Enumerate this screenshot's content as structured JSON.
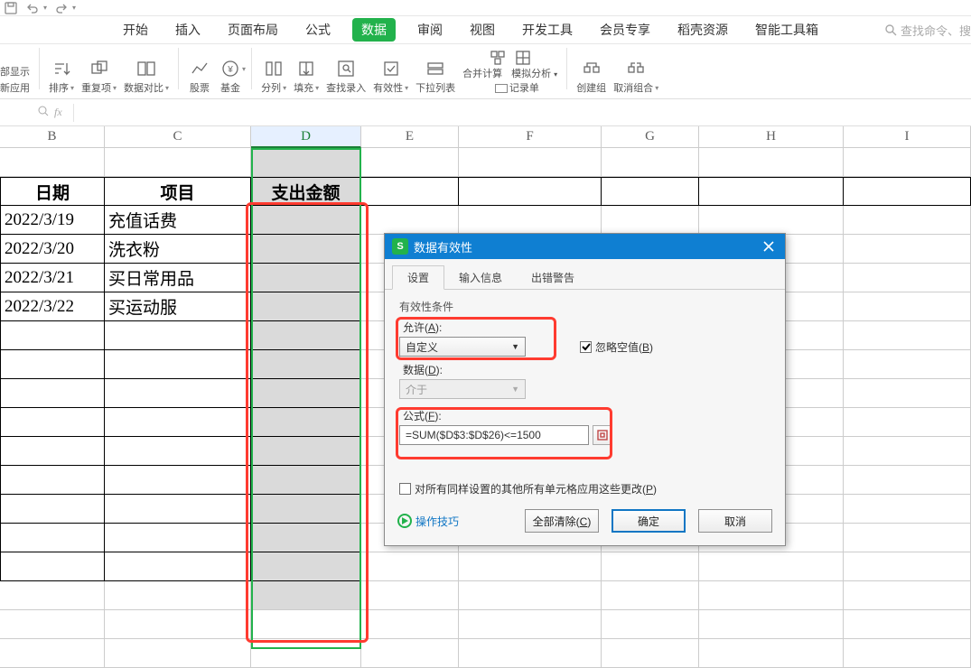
{
  "menu": {
    "items": [
      "开始",
      "插入",
      "页面布局",
      "公式",
      "数据",
      "审阅",
      "视图",
      "开发工具",
      "会员专享",
      "稻壳资源",
      "智能工具箱"
    ],
    "active_index": 4,
    "search_placeholder": "查找命令、搜"
  },
  "ribbon": {
    "left_group_top": "部显示",
    "left_group_bottom": "新应用",
    "sort": "排序",
    "dedup": "重复项",
    "compare": "数据对比",
    "stock": "股票",
    "fund": "基金",
    "split": "分列",
    "fill": "填充",
    "findrec": "查找录入",
    "validity": "有效性",
    "dropdown": "下拉列表",
    "consolidate": "合并计算",
    "simulate": "模拟分析",
    "record": "记录单",
    "creategroup": "创建组",
    "ungroup": "取消组合"
  },
  "fx": {
    "fx_label": "fx"
  },
  "columns": [
    "B",
    "C",
    "D",
    "E",
    "F",
    "G",
    "H",
    "I"
  ],
  "headers": {
    "b": "日期",
    "c": "项目",
    "d": "支出金额"
  },
  "data_rows": [
    {
      "b": "2022/3/19",
      "c": "充值话费"
    },
    {
      "b": "2022/3/20",
      "c": "洗衣粉"
    },
    {
      "b": "2022/3/21",
      "c": "买日常用品"
    },
    {
      "b": "2022/3/22",
      "c": "买运动服"
    }
  ],
  "dialog": {
    "title": "数据有效性",
    "tabs": [
      "设置",
      "输入信息",
      "出错警告"
    ],
    "section_label": "有效性条件",
    "allow_label": "允许(A):",
    "allow_value": "自定义",
    "ignore_blank_label": "忽略空值(B)",
    "ignore_blank_checked": true,
    "data_label": "数据(D):",
    "data_value": "介于",
    "formula_label": "公式(F):",
    "formula_value": "=SUM($D$3:$D$26)<=1500",
    "apply_all_label": "对所有同样设置的其他所有单元格应用这些更改(P)",
    "apply_all_checked": false,
    "tip_link": "操作技巧",
    "clear_all": "全部清除(C)",
    "ok": "确定",
    "cancel": "取消"
  }
}
